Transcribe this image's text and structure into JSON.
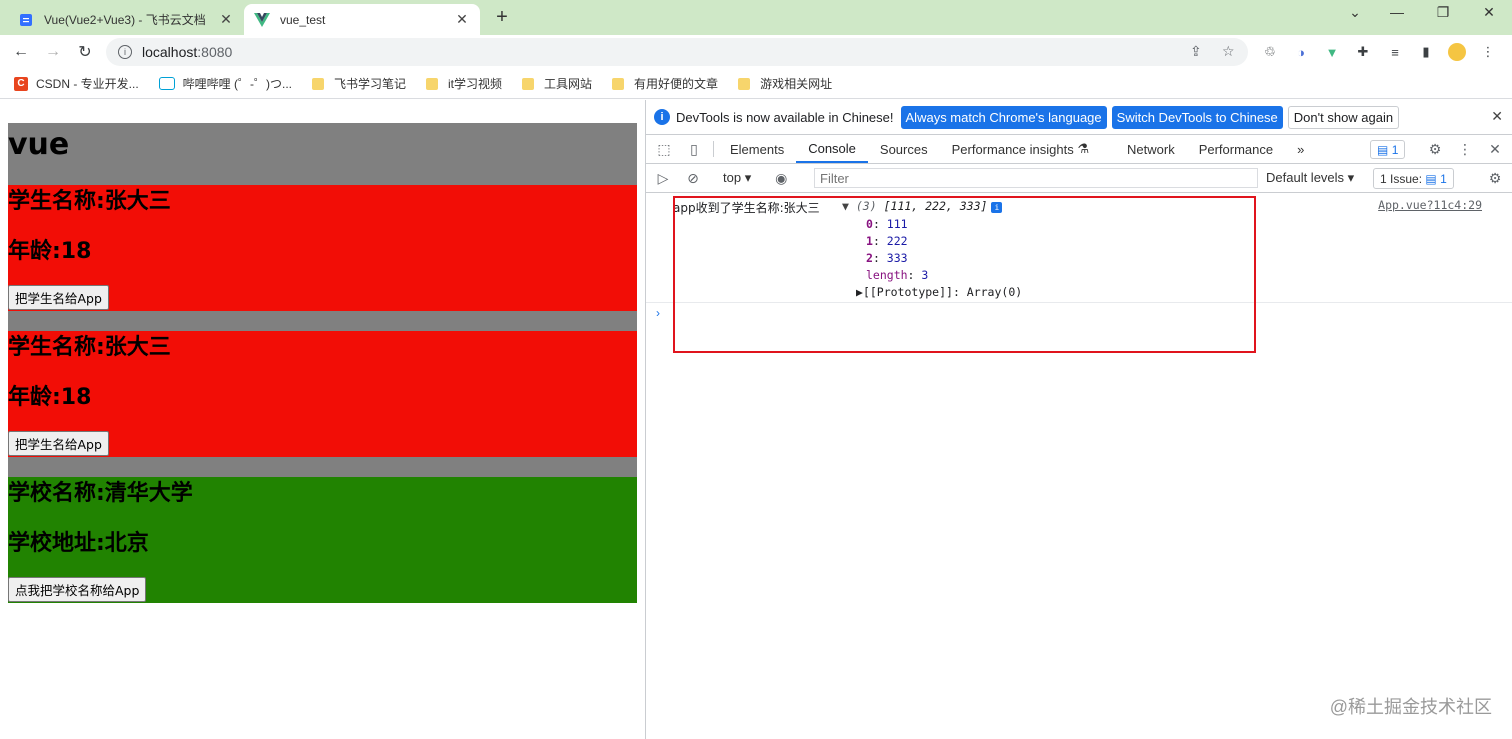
{
  "browser": {
    "tabs": [
      {
        "title": "Vue(Vue2+Vue3) - 飞书云文档",
        "active": false
      },
      {
        "title": "vue_test",
        "active": true
      }
    ],
    "url_host": "localhost",
    "url_port": ":8080",
    "bookmarks": [
      "CSDN - 专业开发...",
      "哔哩哔哩 (゜-゜)つ...",
      "飞书学习笔记",
      "it学习视频",
      "工具网站",
      "有用好便的文章",
      "游戏相关网址"
    ]
  },
  "page": {
    "app_title": "vue",
    "students": [
      {
        "name": "学生名称:张大三",
        "age": "年龄:18",
        "button": "把学生名给App"
      },
      {
        "name": "学生名称:张大三",
        "age": "年龄:18",
        "button": "把学生名给App"
      }
    ],
    "school": {
      "name": "学校名称:清华大学",
      "address": "学校地址:北京",
      "button": "点我把学校名称给App"
    }
  },
  "devtools": {
    "infobar": {
      "message": "DevTools is now available in Chinese!",
      "btn_match": "Always match Chrome's language",
      "btn_switch": "Switch DevTools to Chinese",
      "btn_dismiss": "Don't show again"
    },
    "tabs": [
      "Elements",
      "Console",
      "Sources",
      "Performance insights",
      "Network",
      "Performance"
    ],
    "messages_count": "1",
    "console_toolbar": {
      "context": "top",
      "filter_placeholder": "Filter",
      "levels": "Default levels",
      "issues": "1 Issue:",
      "issues_count": "1"
    },
    "log": {
      "text": "app收到了学生名称:张大三",
      "summary_count": "(3)",
      "summary_values": "[111, 222, 333]",
      "props": [
        {
          "key": "0",
          "value": "111"
        },
        {
          "key": "1",
          "value": "222"
        },
        {
          "key": "2",
          "value": "333"
        }
      ],
      "length_key": "length",
      "length_value": "3",
      "proto": "[[Prototype]]: Array(0)",
      "source": "App.vue?11c4:29"
    }
  },
  "watermark": "@稀土掘金技术社区"
}
